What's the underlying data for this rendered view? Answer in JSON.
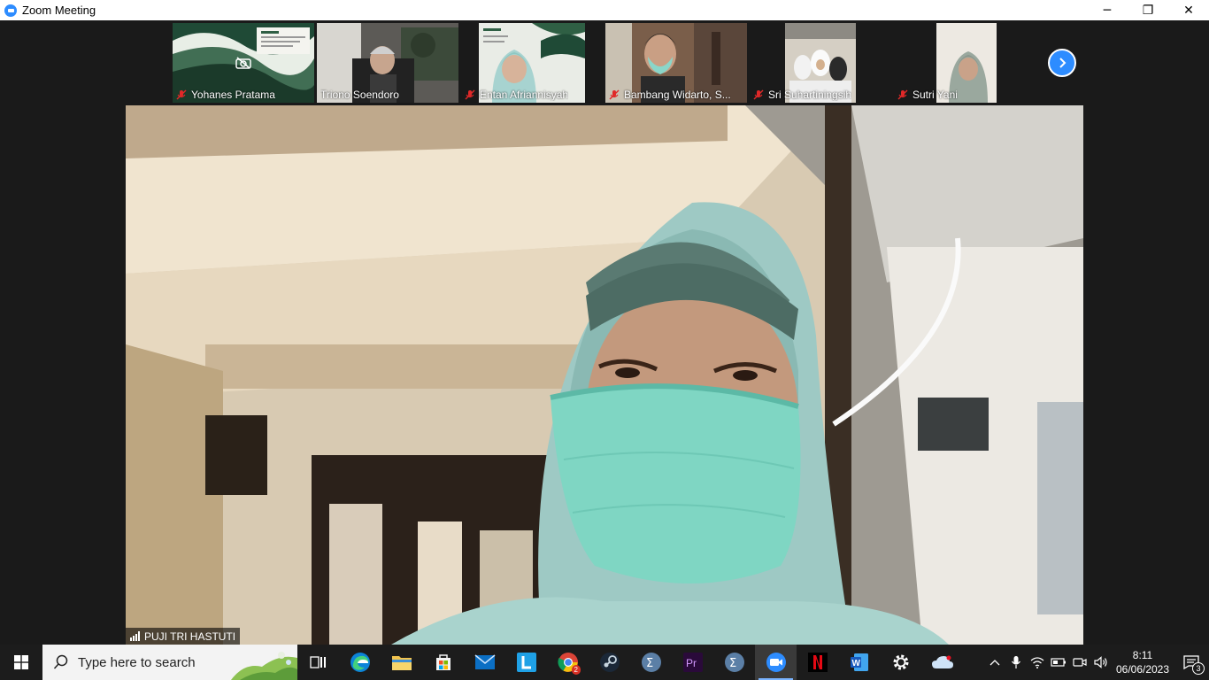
{
  "window": {
    "title": "Zoom Meeting",
    "minimize": "─",
    "restore": "❐",
    "close": "✕"
  },
  "participants": [
    {
      "name": "Yohanes Pratama",
      "muted": true,
      "video_off": true
    },
    {
      "name": "Triono Soendoro",
      "muted": false,
      "video_off": false
    },
    {
      "name": "Entan Afriannisyah",
      "muted": true,
      "video_off": false
    },
    {
      "name": "Bambang Widarto, S...",
      "muted": true,
      "video_off": false
    },
    {
      "name": "Sri Suhartiningsih",
      "muted": true,
      "video_off": false
    },
    {
      "name": "Sutri Yani",
      "muted": true,
      "video_off": false
    }
  ],
  "active_speaker": {
    "name": "PUJI TRI HASTUTI"
  },
  "taskbar": {
    "search_placeholder": "Type here to search",
    "apps": [
      "task-view",
      "edge",
      "file-explorer",
      "microsoft-store",
      "mail",
      "lineage-L",
      "chrome",
      "steam",
      "sigma-app",
      "premiere-pro",
      "sigma-app-2",
      "zoom",
      "netflix",
      "word",
      "settings",
      "onedrive"
    ],
    "active_app": "zoom",
    "chrome_badge": "2",
    "clock_time": "8:11",
    "clock_date": "06/06/2023",
    "notification_count": "3"
  },
  "colors": {
    "zoom_blue": "#2d8cff",
    "mute_red": "#e02828",
    "taskbar_bg": "#1c1c1c"
  }
}
